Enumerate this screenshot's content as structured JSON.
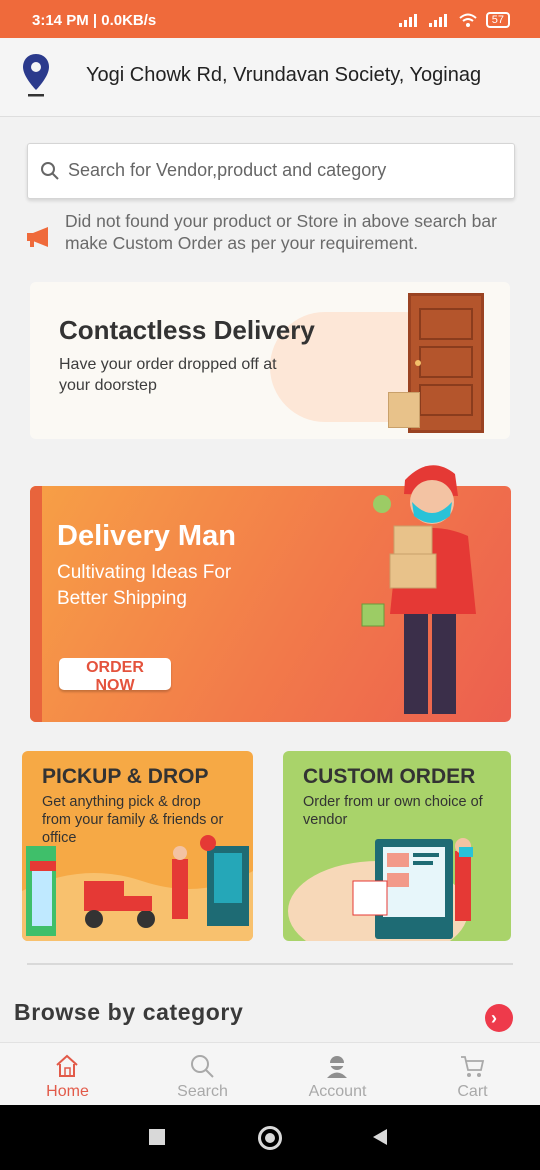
{
  "status_bar": {
    "time": "3:14 PM | 0.0KB/s",
    "battery": "57"
  },
  "header": {
    "address": "Yogi Chowk Rd, Vrundavan Society, Yoginag"
  },
  "search": {
    "placeholder": "Search for Vendor,product and category"
  },
  "notice": {
    "text": "Did not found your product or Store in above search bar make Custom Order as per your requirement."
  },
  "banners": {
    "contactless": {
      "title": "Contactless Delivery",
      "subtitle": "Have your order dropped off at your doorstep"
    },
    "delivery_man": {
      "title": "Delivery Man",
      "subtitle": "Cultivating Ideas For Better Shipping",
      "button": "ORDER NOW"
    },
    "pickup_drop": {
      "title": "PICKUP & DROP",
      "subtitle": "Get anything pick & drop from your family & friends or office"
    },
    "custom_order": {
      "title": "CUSTOM ORDER",
      "subtitle": "Order from ur own choice of vendor"
    }
  },
  "browse": {
    "title": "Browse by category"
  },
  "bottom_nav": {
    "items": [
      {
        "label": "Home",
        "icon": "home-icon",
        "active": true
      },
      {
        "label": "Search",
        "icon": "search-icon",
        "active": false
      },
      {
        "label": "Account",
        "icon": "account-icon",
        "active": false
      },
      {
        "label": "Cart",
        "icon": "cart-icon",
        "active": false
      }
    ]
  },
  "colors": {
    "status_bar": "#ef6a3b",
    "accent": "#e25a49",
    "pin": "#2b3a8c"
  }
}
